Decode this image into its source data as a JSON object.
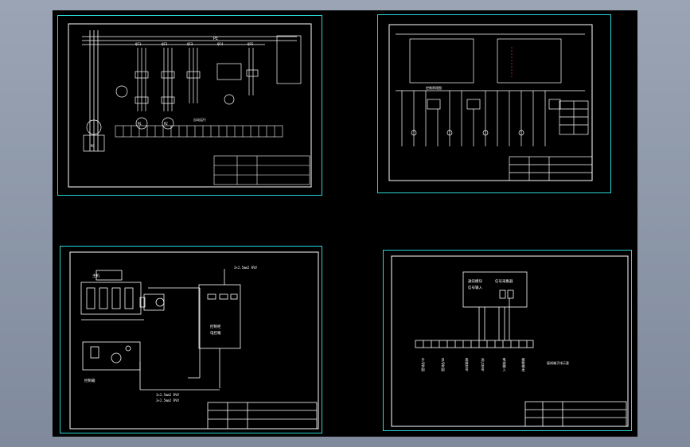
{
  "colors": {
    "background": "#8f99aa",
    "canvas": "#000000",
    "sheet_border": "#2bd3d3",
    "line": "#ffffff",
    "accent_red": "#ff3b3b"
  },
  "sheets": [
    {
      "id": "sheet-1",
      "labels": {
        "bus": "PE",
        "breakers": [
          "QF1",
          "QF2",
          "QF3",
          "QF4",
          "QF5"
        ],
        "motors": [
          "M1",
          "M2",
          "M3"
        ],
        "section": "自动运行"
      }
    },
    {
      "id": "sheet-2",
      "labels": {
        "note": "控制原理图"
      }
    },
    {
      "id": "sheet-3",
      "labels": {
        "machine": "主机",
        "cable_top": "3×2.5mm2 RVV",
        "cable_bottom1": "3×2.5mm2 RVV",
        "cable_bottom2": "3×2.5mm2 RVV",
        "cabinet": "控制柜",
        "cabinet_sub": "电控箱",
        "panel": "控制箱"
      }
    },
    {
      "id": "sheet-4",
      "labels": {
        "module_title": "通讯模块",
        "module_sub": "信号输入",
        "module_right": "信号采集器",
        "terminal_note": "接线端子排示意",
        "col_labels": [
          "手动控制",
          "自动控制",
          "故障信号",
          "运行信号",
          "电源输入",
          "报警输出"
        ]
      }
    }
  ]
}
